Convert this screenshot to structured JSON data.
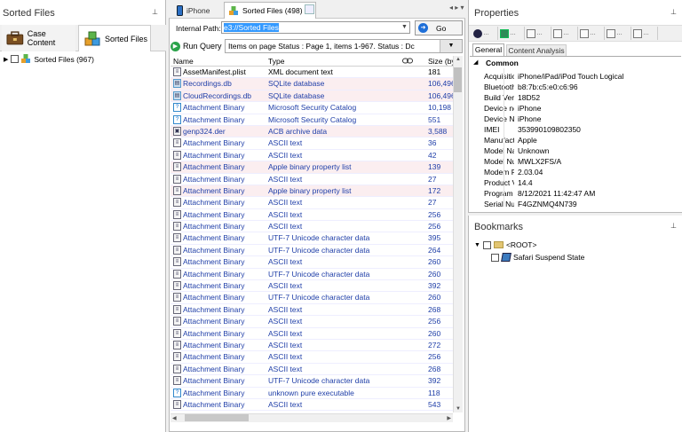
{
  "left": {
    "title": "Sorted Files",
    "pin": "⊥",
    "tabs": [
      {
        "label": "Case Content"
      },
      {
        "label": "Sorted Files"
      }
    ],
    "tree_root": "Sorted Files (967)"
  },
  "middle": {
    "tabs": [
      {
        "label": "iPhone"
      },
      {
        "label": "Sorted Files (498)"
      }
    ],
    "nav_arrows": "◂ ▸ ▾",
    "internal_path_label": "Internal Path:",
    "internal_path_value": "e3://Sorted Files",
    "go_label": "Go",
    "run_query_label": "Run Query",
    "items_text": "Items on page  Status : Page 1, items 1-967. Status : Dc",
    "columns": {
      "name": "Name",
      "type": "Type",
      "size": "Size (by"
    },
    "rows": [
      {
        "name": "AssetManifest.plist",
        "type": "XML document text",
        "size": "181",
        "style": "plain",
        "icon": "doc-icon",
        "pink": false
      },
      {
        "name": "Recordings.db",
        "type": "SQLite database",
        "size": "106,496",
        "style": "blue",
        "icon": "db-icon",
        "pink": true
      },
      {
        "name": "CloudRecordings.db",
        "type": "SQLite database",
        "size": "106,496",
        "style": "blue",
        "icon": "db-icon",
        "pink": true
      },
      {
        "name": "Attachment Binary",
        "type": "Microsoft Security Catalog",
        "size": "10,198",
        "style": "blue",
        "icon": "unknown-file-icon",
        "pink": false
      },
      {
        "name": "Attachment Binary",
        "type": "Microsoft Security Catalog",
        "size": "551",
        "style": "blue",
        "icon": "unknown-file-icon",
        "pink": false
      },
      {
        "name": "genp324.der",
        "type": "ACB archive data",
        "size": "3,588",
        "style": "blue",
        "icon": "archive-icon",
        "pink": true
      },
      {
        "name": "Attachment Binary",
        "type": "ASCII text",
        "size": "36",
        "style": "blue",
        "icon": "text-file-icon",
        "pink": false
      },
      {
        "name": "Attachment Binary",
        "type": "ASCII text",
        "size": "42",
        "style": "blue",
        "icon": "text-file-icon",
        "pink": false
      },
      {
        "name": "Attachment Binary",
        "type": "Apple binary property list",
        "size": "139",
        "style": "blue",
        "icon": "text-file-icon",
        "pink": true
      },
      {
        "name": "Attachment Binary",
        "type": "ASCII text",
        "size": "27",
        "style": "blue",
        "icon": "text-file-icon",
        "pink": false
      },
      {
        "name": "Attachment Binary",
        "type": "Apple binary property list",
        "size": "172",
        "style": "blue",
        "icon": "text-file-icon",
        "pink": true
      },
      {
        "name": "Attachment Binary",
        "type": "ASCII text",
        "size": "27",
        "style": "blue",
        "icon": "text-file-icon",
        "pink": false
      },
      {
        "name": "Attachment Binary",
        "type": "ASCII text",
        "size": "256",
        "style": "blue",
        "icon": "text-file-icon",
        "pink": false
      },
      {
        "name": "Attachment Binary",
        "type": "ASCII text",
        "size": "256",
        "style": "blue",
        "icon": "text-file-icon",
        "pink": false
      },
      {
        "name": "Attachment Binary",
        "type": "UTF-7 Unicode character data",
        "size": "395",
        "style": "blue",
        "icon": "text-file-icon",
        "pink": false
      },
      {
        "name": "Attachment Binary",
        "type": "UTF-7 Unicode character data",
        "size": "264",
        "style": "blue",
        "icon": "text-file-icon",
        "pink": false
      },
      {
        "name": "Attachment Binary",
        "type": "ASCII text",
        "size": "260",
        "style": "blue",
        "icon": "text-file-icon",
        "pink": false
      },
      {
        "name": "Attachment Binary",
        "type": "UTF-7 Unicode character data",
        "size": "260",
        "style": "blue",
        "icon": "text-file-icon",
        "pink": false
      },
      {
        "name": "Attachment Binary",
        "type": "ASCII text",
        "size": "392",
        "style": "blue",
        "icon": "text-file-icon",
        "pink": false
      },
      {
        "name": "Attachment Binary",
        "type": "UTF-7 Unicode character data",
        "size": "260",
        "style": "blue",
        "icon": "text-file-icon",
        "pink": false
      },
      {
        "name": "Attachment Binary",
        "type": "ASCII text",
        "size": "268",
        "style": "blue",
        "icon": "text-file-icon",
        "pink": false
      },
      {
        "name": "Attachment Binary",
        "type": "ASCII text",
        "size": "256",
        "style": "blue",
        "icon": "text-file-icon",
        "pink": false
      },
      {
        "name": "Attachment Binary",
        "type": "ASCII text",
        "size": "260",
        "style": "blue",
        "icon": "text-file-icon",
        "pink": false
      },
      {
        "name": "Attachment Binary",
        "type": "ASCII text",
        "size": "272",
        "style": "blue",
        "icon": "text-file-icon",
        "pink": false
      },
      {
        "name": "Attachment Binary",
        "type": "ASCII text",
        "size": "256",
        "style": "blue",
        "icon": "text-file-icon",
        "pink": false
      },
      {
        "name": "Attachment Binary",
        "type": "ASCII text",
        "size": "268",
        "style": "blue",
        "icon": "text-file-icon",
        "pink": false
      },
      {
        "name": "Attachment Binary",
        "type": "UTF-7 Unicode character data",
        "size": "392",
        "style": "blue",
        "icon": "text-file-icon",
        "pink": false
      },
      {
        "name": "Attachment Binary",
        "type": "unknown pure executable",
        "size": "118",
        "style": "blue",
        "icon": "unknown-file-icon",
        "pink": false
      },
      {
        "name": "Attachment Binary",
        "type": "ASCII text",
        "size": "543",
        "style": "blue",
        "icon": "text-file-icon",
        "pink": false
      }
    ]
  },
  "properties": {
    "title": "Properties",
    "pin": "⊥",
    "tabs": [
      {
        "label": "General"
      },
      {
        "label": "Content Analysis"
      }
    ],
    "section": "Common",
    "section_toggle": "◢",
    "rows": [
      {
        "key": "Acquisitio",
        "value": "iPhone/iPad/iPod Touch Logical"
      },
      {
        "key": "Bluetooth",
        "value": "b8:7b:c5:e0:c6:96"
      },
      {
        "key": "Build Vers",
        "value": "18D52"
      },
      {
        "key": "Device nc",
        "value": "iPhone"
      },
      {
        "key": "Device Na",
        "value": "iPhone"
      },
      {
        "key": "IMEI",
        "value": "353990109802350"
      },
      {
        "key": "Manufact",
        "value": "Apple"
      },
      {
        "key": "Model Nar",
        "value": "Unknown"
      },
      {
        "key": "Model Nur",
        "value": "MWLX2FS/A"
      },
      {
        "key": "Modem Fi",
        "value": "2.03.04"
      },
      {
        "key": "Product V",
        "value": "14.4"
      },
      {
        "key": "Program I",
        "value": "8/12/2021 11:42:47 AM"
      },
      {
        "key": "Serial Nur",
        "value": "F4GZNMQ4N739"
      }
    ],
    "toolbar_buttons": [
      "…",
      "…",
      "…",
      "…",
      "…",
      "…",
      "…"
    ]
  },
  "bookmarks": {
    "title": "Bookmarks",
    "pin": "⊥",
    "root_label": "<ROOT>",
    "child_label": "Safari Suspend State"
  },
  "colors": {
    "link_blue": "#1f3ea8",
    "pink_row": "#fbeef0",
    "selection": "#3399ff",
    "go_blue": "#1e6fd8",
    "run_green": "#2aa34a"
  }
}
